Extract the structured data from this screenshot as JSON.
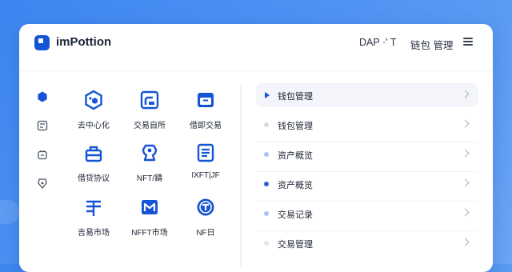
{
  "header": {
    "app_title": "imPottion",
    "nav_a": "DAP ·' T",
    "nav_b": "链包 管理"
  },
  "rail": {
    "icons": [
      "hexagon-icon",
      "chart-icon",
      "bag-icon",
      "shield-icon"
    ],
    "active_index": 0
  },
  "grid": {
    "tiles": [
      {
        "icon": "hex-node-icon",
        "label": "去中心化"
      },
      {
        "icon": "trade-chart-icon",
        "label": "交易自所"
      },
      {
        "icon": "wallet-box-icon",
        "label": "借即交易"
      },
      {
        "icon": "lock-box-icon",
        "label": "借贷协议"
      },
      {
        "icon": "nft-badge-icon",
        "label": "NFT/錆"
      },
      {
        "icon": "document-icon",
        "label": "IXFT|JF"
      },
      {
        "icon": "exchange-icon",
        "label": "吉易市场"
      },
      {
        "icon": "market-m-icon",
        "label": "NFFT市场"
      },
      {
        "icon": "nft-coin-icon",
        "label": "NF日"
      }
    ]
  },
  "list": {
    "items": [
      {
        "label": "钱包管理",
        "marker": "arrow",
        "active": true
      },
      {
        "label": "钱包管理",
        "marker": "dot",
        "color": "#d6dae2"
      },
      {
        "label": "资产概览",
        "marker": "dot",
        "color": "#a9c2f2"
      },
      {
        "label": "资产概览",
        "marker": "dot",
        "color": "#2a62d8"
      },
      {
        "label": "交易记录",
        "marker": "dot",
        "color": "#a9c2f2"
      },
      {
        "label": "交易管理",
        "marker": "dot",
        "color": "#e3e6ec"
      }
    ]
  },
  "colors": {
    "accent": "#1554d4",
    "background": "#4f93f3",
    "text": "#1c2333"
  }
}
